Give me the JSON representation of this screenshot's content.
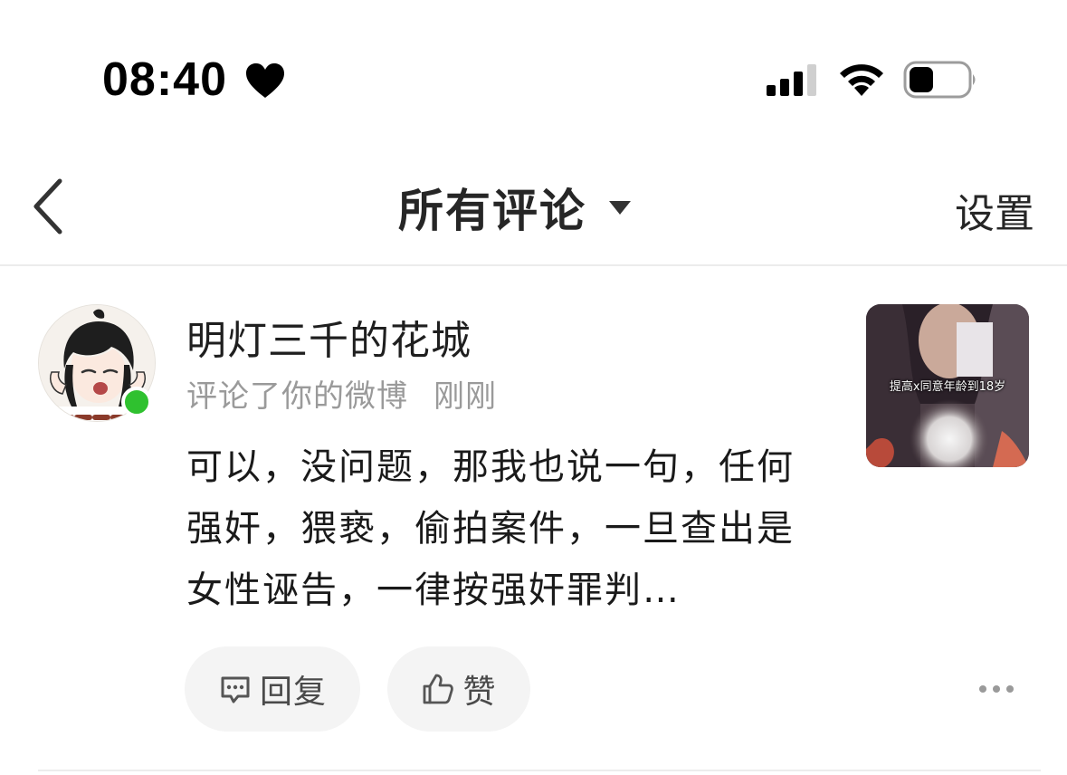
{
  "status_bar": {
    "time": "08:40"
  },
  "nav": {
    "title": "所有评论",
    "settings_label": "设置"
  },
  "comment": {
    "username": "明灯三千的花城",
    "action_text": "评论了你的微博",
    "time": "刚刚",
    "content": "可以，没问题，那我也说一句，任何强奸，猥亵，偷拍案件，一旦查出是女性诬告，一律按强奸罪判…",
    "thumbnail_caption": "提高x同意年龄到18岁",
    "reply_label": "回复",
    "like_label": "赞"
  },
  "colors": {
    "online_dot": "#2fc12f",
    "pill_background": "#f4f4f4",
    "secondary_text": "#9a9a9a"
  }
}
